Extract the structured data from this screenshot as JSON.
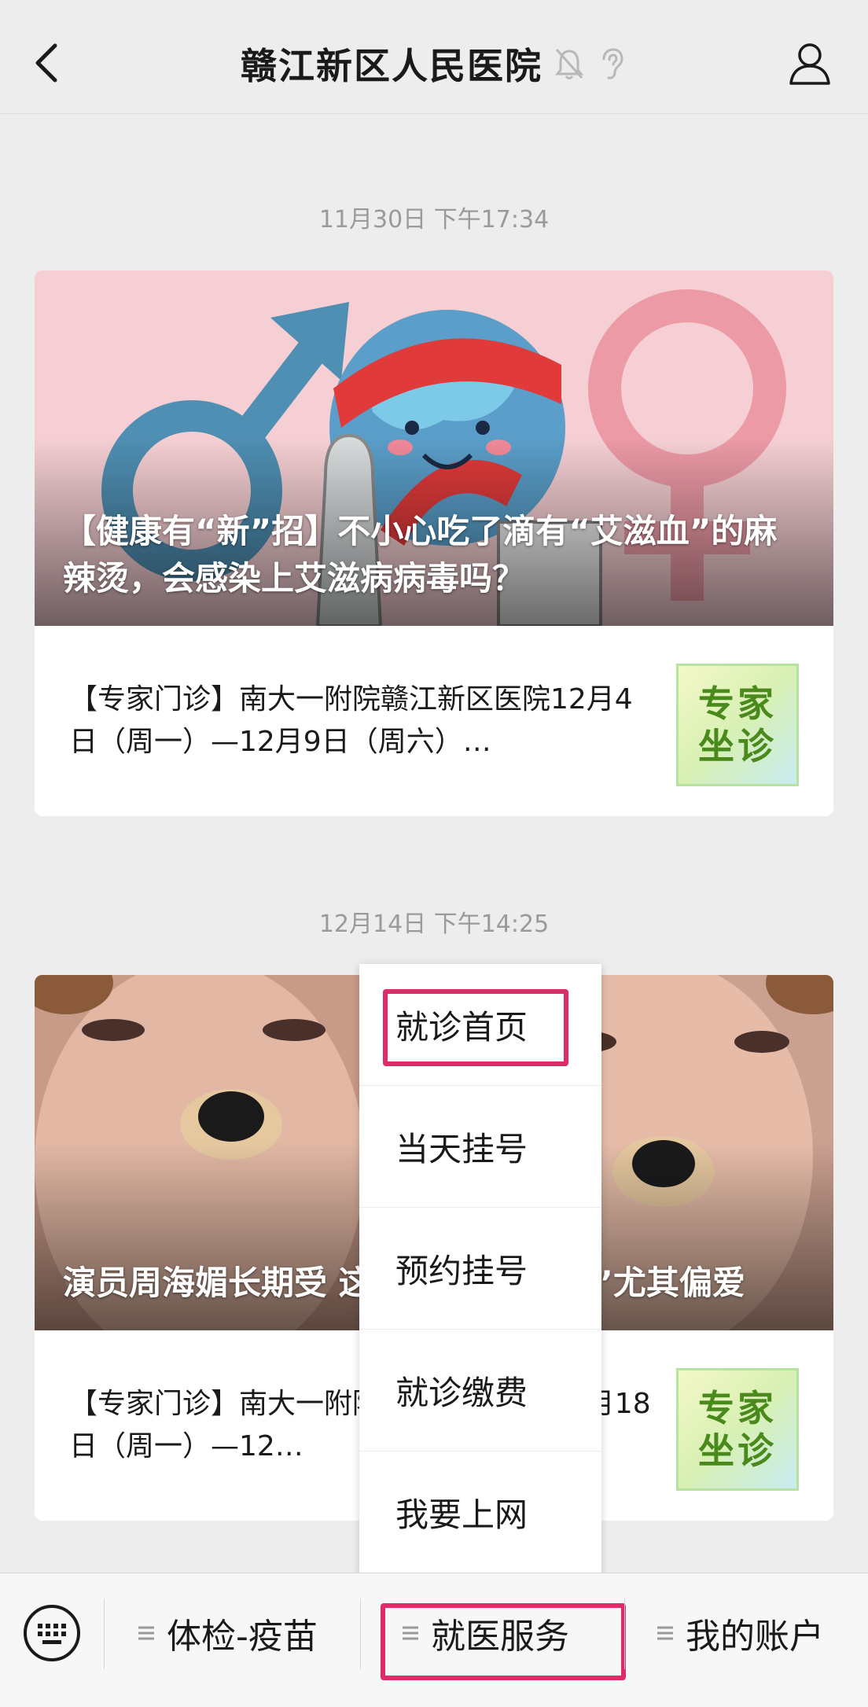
{
  "header": {
    "title": "赣江新区人民医院",
    "icons": [
      "back-icon",
      "mute-bell-icon",
      "ear-icon",
      "profile-icon"
    ]
  },
  "messages": [
    {
      "timestamp": "11月30日 下午17:34",
      "cover_title": "【健康有“新”招】不小心吃了滴有“艾滋血”的麻辣烫，会感染上艾滋病病毒吗？",
      "row_text": "【专家门诊】南大一附院赣江新区医院12月4日（周一）—12月9日（周六）…",
      "thumb_lines": [
        "专家",
        "坐诊"
      ]
    },
    {
      "timestamp": "12月14日 下午14:25",
      "cover_title": "演员周海媚长期受 这种“不死的癌症”尤其偏爱",
      "row_text": "【专家门诊】南大一附院赣江新区医院12月18日（周一）—12…",
      "thumb_lines": [
        "专家",
        "坐诊"
      ]
    }
  ],
  "popup_menu": {
    "items": [
      "就诊首页",
      "当天挂号",
      "预约挂号",
      "就诊缴费",
      "我要上网"
    ]
  },
  "bottom_bar": {
    "tabs": [
      "体检-疫苗",
      "就医服务",
      "我的账户"
    ]
  },
  "colors": {
    "highlight": "#e02a6a",
    "background": "#ededed"
  }
}
